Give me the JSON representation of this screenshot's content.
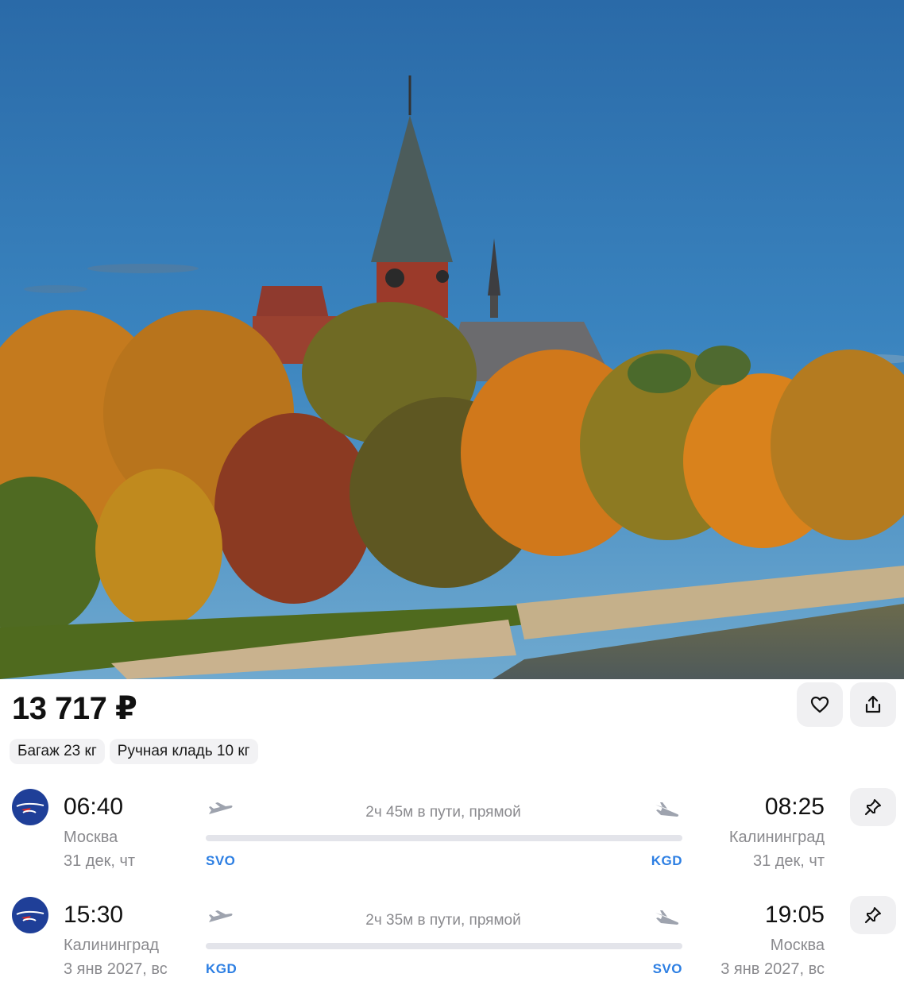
{
  "hero": {
    "description_icon": "photo"
  },
  "price": {
    "amount": "13 717 ₽"
  },
  "actions": {
    "favorite_icon": "heart-icon",
    "share_icon": "share-icon"
  },
  "tags": [
    {
      "label": "Багаж 23 кг"
    },
    {
      "label": "Ручная кладь 10 кг"
    }
  ],
  "segments": [
    {
      "dep_time": "06:40",
      "dep_city": "Москва",
      "dep_date": "31 дек, чт",
      "duration": "2ч 45м в пути, прямой",
      "from_code": "SVO",
      "to_code": "KGD",
      "arr_time": "08:25",
      "arr_city": "Калининград",
      "arr_date": "31 дек, чт"
    },
    {
      "dep_time": "15:30",
      "dep_city": "Калининград",
      "dep_date": "3 янв 2027, вс",
      "duration": "2ч 35м в пути, прямой",
      "from_code": "KGD",
      "to_code": "SVO",
      "arr_time": "19:05",
      "arr_city": "Москва",
      "arr_date": "3 янв 2027, вс"
    }
  ],
  "colors": {
    "accent": "#2d7fe3",
    "muted": "#8a8a8e",
    "button_bg": "#f0f0f2",
    "airline_logo": "#1f3f98"
  }
}
